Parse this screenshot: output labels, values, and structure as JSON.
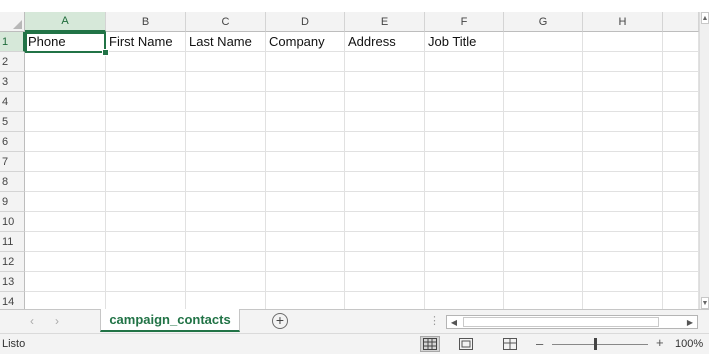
{
  "sheet": {
    "columns": [
      "A",
      "B",
      "C",
      "D",
      "E",
      "F",
      "G",
      "H"
    ],
    "rows": [
      "1",
      "2",
      "3",
      "4",
      "5",
      "6",
      "7",
      "8",
      "9",
      "10",
      "11",
      "12",
      "13",
      "14"
    ],
    "header_row": [
      "Phone",
      "First Name",
      "Last Name",
      "Company",
      "Address",
      "Job Title",
      "",
      ""
    ],
    "selected_cell": "A1"
  },
  "tabs": {
    "active_tab": "campaign_contacts",
    "prev_arrow": "‹",
    "next_arrow": "›",
    "add_sheet": "+"
  },
  "statusbar": {
    "status_text": "Listo",
    "zoom_minus": "–",
    "zoom_plus": "+",
    "zoom_level": "100%",
    "zoom_fraction": 0.45
  },
  "icons": {
    "normal_view": "normal-view-icon",
    "page_layout": "page-layout-icon",
    "page_break": "page-break-preview-icon",
    "add_sheet": "add-sheet-icon"
  },
  "colors": {
    "accent": "#217346",
    "selected_header_bg": "#d6e8d9"
  }
}
